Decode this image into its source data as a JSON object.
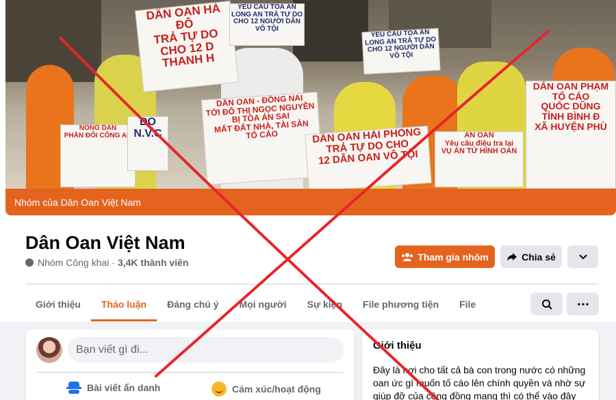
{
  "cover": {
    "band_label": "Nhóm của Dân Oan Việt Nam",
    "signs": [
      "DÂN OAN HÀ ĐÔ\nTRẢ TỰ DO\nCHO 12 D\nTHANH H",
      "YÊU CẦU TÒA ÁN\nLONG AN TRẢ TỰ DO\nCHO 12 NGƯỜI DÂN\nVÔ TỘI",
      "YÊU CẦU TÒA ÁN\nLONG AN TRẢ TỰ DO\nCHO 12 NGƯỜI DÂN\nVÔ TỘI",
      "DÂN OAN - ĐỒNG NAI\nTỚI ĐÔ THỊ NGỌC NGUYỄN\nBỊ TÒA ÁN SAI\nMẤT ĐẤT NHÀ, TÀI SẢN\nTỐ CÁO",
      "DÂN OAN HẢI PHÒNG\nTRẢ TỰ DO CHO\n12 DÂN OAN VÔ TỘI",
      "AN OAN\nYêu cầu điều tra lại\nVỤ ÁN TỬ HÌNH OAN",
      "DÂN OAN PHẠM\nTỐ CÁO\nQUỐC DŨNG\nTỈNH BÌNH Đ\nXÃ HUYỆN PHÙ",
      "NÔNG DÂN\nPHẢN ĐỐI CÔNG AN",
      "DO\nN.V.C"
    ]
  },
  "group": {
    "name": "Dân Oan Việt Nam",
    "privacy": "Nhóm Công khai",
    "separator": "·",
    "members": "3,4K thành viên"
  },
  "actions": {
    "join": "Tham gia nhóm",
    "share": "Chia sẻ",
    "more_icon": "chevron-down-icon"
  },
  "tabs": [
    "Giới thiệu",
    "Thảo luận",
    "Đáng chú ý",
    "Mọi người",
    "Sự kiện",
    "File phương tiện",
    "File"
  ],
  "active_tab": "Thảo luận",
  "composer": {
    "placeholder": "Bạn viết gì đi...",
    "anonymous_post": "Bài viết ẩn danh",
    "feeling_activity": "Cảm xúc/hoạt động"
  },
  "intro": {
    "title": "Giới thiệu",
    "text": "Đây là nơi cho tất cả bà con trong nước có những oan ức gì muốn tố cáo lên chính quyền và nhờ sự giúp đỡ của cộng đồng mạng thì có thể vào đây"
  },
  "colors": {
    "brand": "#e4631f",
    "overlay_x": "#e8242b"
  }
}
